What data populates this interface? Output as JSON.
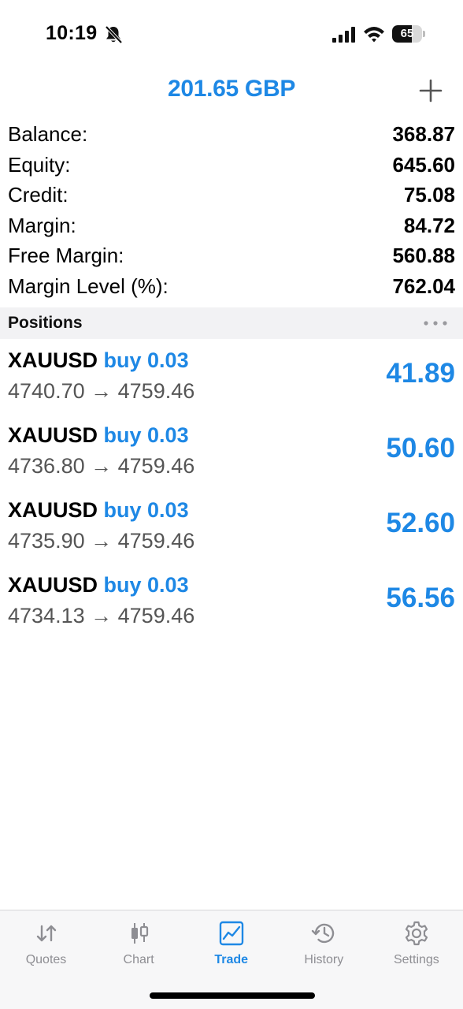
{
  "status_bar": {
    "time": "10:19",
    "battery_level": "65",
    "battery_fraction": 0.65,
    "icons": [
      "bell-slash-icon",
      "cellular-signal-icon",
      "wifi-icon",
      "battery-icon"
    ]
  },
  "header": {
    "title": "201.65 GBP",
    "add_icon": "plus-icon"
  },
  "summary": [
    {
      "label": "Balance:",
      "value": "368.87"
    },
    {
      "label": "Equity:",
      "value": "645.60"
    },
    {
      "label": "Credit:",
      "value": "75.08"
    },
    {
      "label": "Margin:",
      "value": "84.72"
    },
    {
      "label": "Free Margin:",
      "value": "560.88"
    },
    {
      "label": "Margin Level (%):",
      "value": "762.04"
    }
  ],
  "positions_section": {
    "title": "Positions",
    "more_icon": "ellipsis-icon"
  },
  "positions": [
    {
      "symbol": "XAUUSD",
      "side": "buy 0.03",
      "open_price": "4740.70",
      "arrow": "→",
      "current_price": "4759.46",
      "profit": "41.89"
    },
    {
      "symbol": "XAUUSD",
      "side": "buy 0.03",
      "open_price": "4736.80",
      "arrow": "→",
      "current_price": "4759.46",
      "profit": "50.60"
    },
    {
      "symbol": "XAUUSD",
      "side": "buy 0.03",
      "open_price": "4735.90",
      "arrow": "→",
      "current_price": "4759.46",
      "profit": "52.60"
    },
    {
      "symbol": "XAUUSD",
      "side": "buy 0.03",
      "open_price": "4734.13",
      "arrow": "→",
      "current_price": "4759.46",
      "profit": "56.56"
    }
  ],
  "tabs": [
    {
      "label": "Quotes",
      "icon": "quotes-arrows-icon",
      "active": false
    },
    {
      "label": "Chart",
      "icon": "candlestick-chart-icon",
      "active": false
    },
    {
      "label": "Trade",
      "icon": "trade-chart-icon",
      "active": true
    },
    {
      "label": "History",
      "icon": "history-clock-icon",
      "active": false
    },
    {
      "label": "Settings",
      "icon": "gear-icon",
      "active": false
    }
  ],
  "colors": {
    "accent": "#1e88e5",
    "section_bg": "#f2f2f4",
    "inactive_tab": "#8e8e93",
    "secondary_text": "#555555"
  }
}
